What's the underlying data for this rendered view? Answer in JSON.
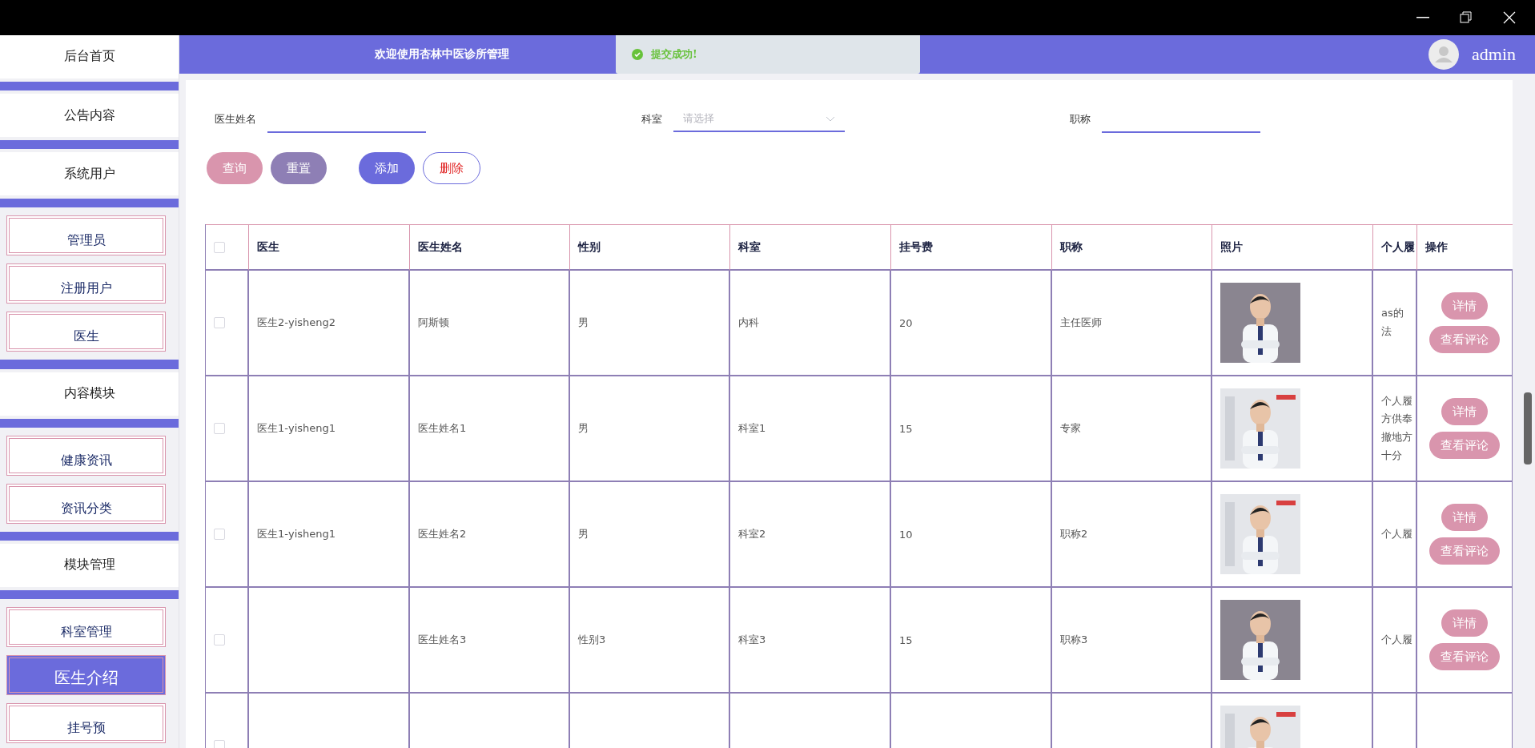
{
  "header": {
    "title": "欢迎使用杏林中医诊所管理",
    "toast": {
      "text": "提交成功!"
    },
    "user": {
      "name": "admin"
    }
  },
  "sidebar": {
    "groups": [
      {
        "label": "后台首页"
      },
      {
        "label": "公告内容"
      },
      {
        "label": "系统用户",
        "children": [
          {
            "label": "管理员",
            "selected": false
          },
          {
            "label": "注册用户",
            "selected": false
          },
          {
            "label": "医生",
            "selected": false
          }
        ]
      },
      {
        "label": "内容模块",
        "children": [
          {
            "label": "健康资讯",
            "selected": false
          },
          {
            "label": "资讯分类",
            "selected": false
          }
        ]
      },
      {
        "label": "模块管理",
        "children": [
          {
            "label": "科室管理",
            "selected": false
          },
          {
            "label": "医生介绍",
            "selected": true
          },
          {
            "label": "挂号预",
            "selected": false
          }
        ]
      }
    ]
  },
  "search": {
    "fields": [
      {
        "label": "医生姓名",
        "kind": "text"
      },
      {
        "label": "科室",
        "kind": "select",
        "placeholder": "请选择"
      },
      {
        "label": "职称",
        "kind": "text"
      }
    ],
    "buttons": [
      {
        "label": "查询",
        "kind": "query"
      },
      {
        "label": "重置",
        "kind": "reset"
      },
      {
        "label": "添加",
        "kind": "add"
      },
      {
        "label": "删除",
        "kind": "delete"
      }
    ]
  },
  "table": {
    "all_checked": false,
    "columns": [
      "医生",
      "医生姓名",
      "性别",
      "科室",
      "挂号费",
      "职称",
      "照片",
      "个人履",
      "操作"
    ],
    "rows": [
      {
        "checked": false,
        "cells": [
          "医生2-yisheng2",
          "阿斯顿",
          "男",
          "内科",
          "20",
          "主任医师"
        ],
        "photo": {
          "kind": "picture"
        },
        "bio": "as的法",
        "actions": [
          "详情",
          "查看评论"
        ]
      },
      {
        "checked": false,
        "cells": [
          "医生1-yisheng1",
          "医生姓名1",
          "男",
          "科室1",
          "15",
          "专家"
        ],
        "photo": {
          "kind": "picture"
        },
        "bio": "个人履方供奉撤地方十分",
        "actions": [
          "详情",
          "查看评论"
        ]
      },
      {
        "checked": false,
        "cells": [
          "医生1-yisheng1",
          "医生姓名2",
          "男",
          "科室2",
          "10",
          "职称2"
        ],
        "photo": {
          "kind": "picture"
        },
        "bio": "个人履",
        "actions": [
          "详情",
          "查看评论"
        ]
      },
      {
        "checked": false,
        "cells": [
          null,
          "医生姓名3",
          "性别3",
          "科室3",
          "15",
          "职称3"
        ],
        "photo": {
          "kind": "picture"
        },
        "bio": "个人履",
        "actions": [
          "详情",
          "查看评论"
        ]
      },
      {
        "checked": false,
        "photo": {
          "kind": "picture"
        }
      }
    ]
  }
}
